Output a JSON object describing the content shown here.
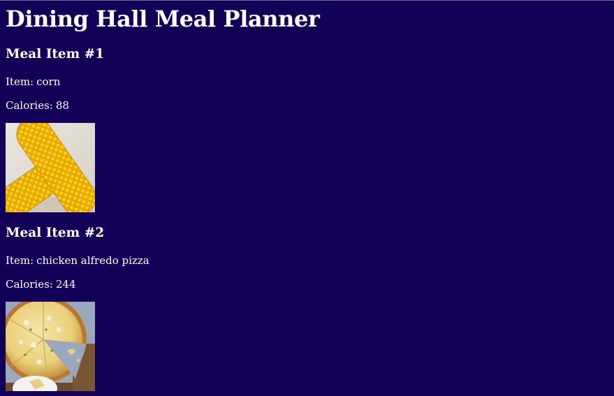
{
  "page": {
    "title": "Dining Hall Meal Planner"
  },
  "meal_items": [
    {
      "heading": "Meal Item #1",
      "item_label": "Item:",
      "item_value": "corn",
      "calories_label": "Calories:",
      "calories_value": "88"
    },
    {
      "heading": "Meal Item #2",
      "item_label": "Item:",
      "item_value": "chicken alfredo pizza",
      "calories_label": "Calories:",
      "calories_value": "244"
    }
  ],
  "colors": {
    "background": "#130057",
    "text": "#ffffff"
  }
}
